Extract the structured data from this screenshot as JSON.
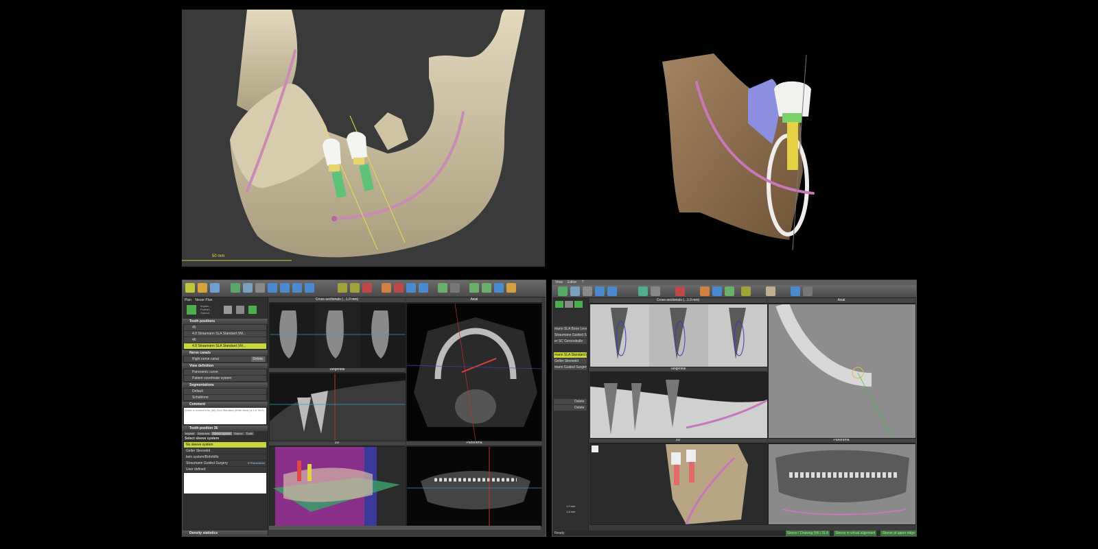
{
  "top_left_3d": {
    "scale_label": "50 mm"
  },
  "left_app": {
    "sidebar": {
      "plan_label": "Plan",
      "plan_name": "Neuer Plan",
      "tools": [
        "Implan...",
        "Prothet...",
        "Ostomi..."
      ],
      "sections": {
        "tooth_positions": "Tooth positions",
        "nerve_canals": "Nerve canals",
        "view_definition": "View definition",
        "segmentations": "Segmentations",
        "comment": "Comment",
        "tooth_position_36": "Tooth position 36",
        "density_statistics": "Density statistics"
      },
      "tooth_rows": [
        {
          "label": "45",
          "value": "4.8",
          "implant": "Straumann SLA Standard (Wi..."
        },
        {
          "label": "46",
          "value": "4.8",
          "implant": "Straumann SLA Standard (Wi..."
        }
      ],
      "nerve_row": {
        "label": "Right nerve canal",
        "button": "Delete"
      },
      "view_rows": [
        "Panoramic curve",
        "Patient coordinate system"
      ],
      "segment_rows": [
        "Default",
        "Schablone"
      ],
      "comment_placeholder": "(Enter a comment for (36) SLA Standard (Wide Neck) ø 4.8 'Sint')",
      "tabs": [
        "Implant",
        "Abutment",
        "Sleeve system",
        "Sleeve",
        "Tooth"
      ],
      "select_label": "Select sleeve system",
      "sleeve_options": [
        "No sleeve system",
        "Geller Sleevekit",
        "kein system/Bohrhilfe",
        "Straumann Guided Surgery",
        "User defined"
      ],
      "brand": "STRAUMANN"
    },
    "views": {
      "cross_sectionals": "Cross-sectionals (...1.0 mm)",
      "axial": "Axial",
      "tangential": "Tangential",
      "three_d": "3D",
      "panorama": "Panorama"
    }
  },
  "right_app": {
    "menu": [
      "View",
      "Editor",
      "?"
    ],
    "views": {
      "cross_sectionals": "Cross-sectionals (...1.0 mm)",
      "axial": "Axial",
      "tangential": "Tangential",
      "three_d": "3D",
      "panorama": "Panorama"
    },
    "sidebar_items": [
      "mann SLA Bone Level (Roxo...",
      "Straumann Guided Surgery",
      "er SC Geroosbulle",
      "mann SLA Standard (Wi...)",
      "Geller Sleevekit",
      "mann Guided Surgery"
    ],
    "sidebar_buttons": [
      "Delete",
      "Delete"
    ],
    "measure_rows": [
      "1.0 mm",
      "1.6 mm"
    ],
    "status_segments": [
      "Ready",
      "Sleeve / Drawing (Wi.) SLA",
      "Sleeve in virtual alignment",
      "Sleeve at upper edge"
    ]
  }
}
